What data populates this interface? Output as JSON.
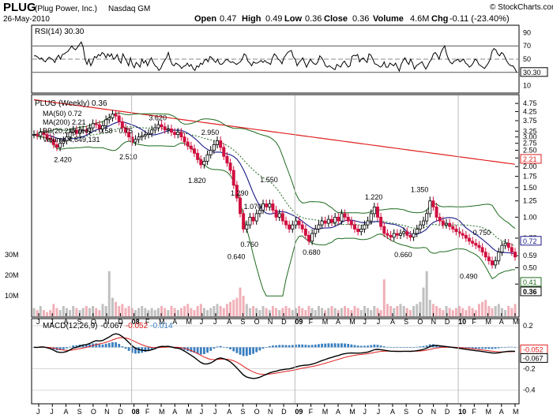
{
  "header": {
    "symbol": "PLUG",
    "company": "(Plug Power, Inc.)",
    "exchange": "Nasdaq GM",
    "date": "26-May-2010",
    "watermark": "© StockCharts.com",
    "open_label": "Open",
    "open": "0.47",
    "high_label": "High",
    "high": "0.49",
    "low_label": "Low",
    "low": "0.36",
    "close_label": "Close",
    "close": "0.36",
    "volume_label": "Volume",
    "volume": "4.6M",
    "chg_label": "Chg",
    "chg": "-0.11 (-23.40%)"
  },
  "colors": {
    "up_candle": "#000000",
    "down_candle": "#d01040",
    "ma50": "#1a1a8a",
    "ma200": "#e02020",
    "bollinger": "#1f6b1f",
    "bb_mid": "#1f6b1f",
    "volume": "#c0c0c0",
    "volume_down": "#f0b0b8",
    "macd_line": "#000000",
    "signal_line": "#e02020",
    "histogram": "#3a7fc0"
  },
  "chart_data": [
    {
      "type": "line",
      "panel": "rsi",
      "label": "RSI(14) 30.30",
      "ylim": [
        0,
        100
      ],
      "y_ticks": [
        10,
        30,
        50,
        70,
        90
      ],
      "overbought": 70,
      "oversold": 30,
      "last_value": "30.30",
      "values": [
        55,
        55,
        53,
        50,
        52,
        48,
        46,
        50,
        53,
        51,
        49,
        45,
        52,
        56,
        50,
        57,
        58,
        60,
        62,
        66,
        70,
        66,
        64,
        68,
        72,
        76,
        68,
        50,
        42,
        50,
        40,
        46,
        54,
        52,
        57,
        55,
        60,
        58,
        52,
        58,
        54,
        58,
        50,
        52,
        57,
        48,
        44,
        58,
        52,
        47,
        40,
        52,
        42,
        37,
        45,
        42,
        38,
        50,
        44,
        48,
        40,
        47,
        52,
        45,
        40,
        38,
        33,
        36,
        43,
        48,
        52,
        60,
        49,
        42,
        40,
        44,
        42,
        40,
        36,
        39,
        40,
        44,
        39,
        42,
        36,
        33,
        40,
        38,
        44,
        42,
        48,
        50,
        46,
        54,
        52,
        48,
        45,
        50,
        43,
        42,
        44,
        48,
        50,
        47,
        45,
        46,
        44,
        42,
        44,
        46,
        50,
        58,
        56,
        47,
        44,
        40,
        46,
        44,
        44,
        46,
        48,
        45,
        48,
        45,
        44,
        42,
        52,
        58,
        55,
        50,
        48,
        43,
        52,
        56,
        60,
        62,
        63,
        53,
        50,
        40,
        45,
        48,
        52,
        45,
        38,
        44,
        50,
        46,
        43,
        42,
        46,
        55,
        52,
        47,
        40,
        38,
        40,
        38,
        36,
        34,
        42,
        40,
        38,
        44,
        47,
        42,
        38,
        40,
        54,
        56,
        55,
        57,
        46,
        50,
        52,
        48,
        45,
        58,
        56,
        50,
        43,
        42,
        40,
        38,
        40,
        46,
        38,
        38,
        44,
        42,
        40,
        44,
        38,
        32,
        42,
        48,
        52,
        46,
        42,
        50,
        44,
        35,
        40,
        42,
        44,
        46,
        40,
        35,
        40,
        46,
        50,
        58,
        60,
        56,
        50,
        60,
        66,
        70,
        58,
        50,
        45,
        43,
        47,
        48,
        50,
        46,
        48,
        50,
        44,
        42,
        38,
        40,
        44,
        50,
        48,
        42,
        40,
        38,
        36,
        40,
        44,
        50,
        62,
        66,
        64,
        58,
        55,
        60,
        58,
        52,
        46,
        42,
        40,
        40,
        36,
        30
      ]
    },
    {
      "type": "candlestick",
      "panel": "price",
      "label": "PLUG (Weekly) 0.36",
      "scale": "log",
      "y_ticks": [
        0.4,
        0.5,
        0.59,
        0.75,
        1.0,
        1.25,
        1.5,
        1.75,
        2.0,
        2.25,
        2.5,
        2.75,
        3.0,
        3.25,
        3.75,
        4.25,
        4.75
      ],
      "y_tick_labels": [
        "0.40",
        "0.50",
        "0.59",
        "0.75",
        "1.00",
        "1.25",
        "1.50",
        "1.75",
        "2.00",
        "2.25",
        "2.50",
        "2.75",
        "3.00",
        "3.25",
        "3.75",
        "4.25",
        "4.75"
      ],
      "indicators": {
        "ma50": {
          "label": "MA(50) 0.72",
          "last": "0.72"
        },
        "ma200": {
          "label": "MA(200) 2.21",
          "last": "2.21"
        },
        "bb": {
          "label": "BB(20,2.0) 0.41 - 0.58 - 0.75",
          "upper": "0.75",
          "mid": "0.58",
          "lower": "0.41"
        },
        "volume": {
          "label": "Volume 4,649,131"
        }
      },
      "last_close_label": "0.36",
      "annotations": [
        {
          "label": "3.620",
          "x": 38,
          "y": 3.62
        },
        {
          "label": "2.420",
          "x": 9,
          "y": 2.42
        },
        {
          "label": "2.510",
          "x": 29,
          "y": 2.51
        },
        {
          "label": "2.950",
          "x": 54,
          "y": 2.95
        },
        {
          "label": "1.820",
          "x": 50,
          "y": 1.82
        },
        {
          "label": "1.550",
          "x": 72,
          "y": 1.55
        },
        {
          "label": "1.290",
          "x": 63,
          "y": 1.29
        },
        {
          "label": "1.070",
          "x": 67,
          "y": 1.07
        },
        {
          "label": "0.760",
          "x": 66,
          "y": 0.76
        },
        {
          "label": "0.640",
          "x": 62,
          "y": 0.64
        },
        {
          "label": "1.220",
          "x": 104,
          "y": 1.22
        },
        {
          "label": "0.680",
          "x": 85,
          "y": 0.68
        },
        {
          "label": "1.350",
          "x": 118,
          "y": 1.35
        },
        {
          "label": "0.660",
          "x": 113,
          "y": 0.66
        },
        {
          "label": "0.750",
          "x": 137,
          "y": 0.75
        },
        {
          "label": "0.490",
          "x": 133,
          "y": 0.49
        }
      ],
      "volume_axis": {
        "ticks": [
          10,
          20,
          30
        ],
        "tick_labels": [
          "10M",
          "20M",
          "30M"
        ]
      },
      "weeks": 148,
      "close": [
        3.1,
        3.05,
        3.2,
        3.1,
        2.95,
        2.9,
        2.7,
        2.6,
        2.75,
        2.85,
        3.0,
        3.2,
        3.3,
        3.15,
        3.3,
        3.3,
        3.25,
        3.4,
        3.6,
        3.55,
        3.35,
        3.5,
        3.8,
        3.9,
        4.1,
        4.0,
        3.7,
        3.4,
        3.2,
        3.0,
        2.8,
        2.9,
        3.0,
        3.05,
        3.1,
        3.15,
        3.3,
        3.4,
        3.55,
        3.45,
        3.3,
        3.35,
        3.2,
        3.1,
        3.2,
        3.0,
        2.8,
        2.65,
        2.55,
        2.4,
        2.2,
        2.05,
        2.15,
        2.35,
        2.5,
        2.7,
        2.85,
        2.6,
        2.3,
        2.1,
        1.9,
        1.55,
        1.3,
        1.05,
        0.85,
        0.9,
        1.0,
        0.95,
        1.05,
        1.1,
        1.2,
        1.15,
        1.2,
        1.1,
        1.0,
        1.05,
        0.95,
        0.9,
        0.85,
        0.9,
        0.95,
        0.9,
        0.85,
        0.78,
        0.72,
        0.8,
        0.85,
        0.9,
        0.95,
        0.92,
        0.97,
        0.93,
        1.0,
        0.95,
        1.05,
        1.0,
        0.95,
        0.9,
        0.85,
        0.82,
        0.85,
        0.9,
        0.95,
        1.05,
        1.15,
        1.0,
        0.88,
        0.8,
        0.78,
        0.76,
        0.8,
        0.78,
        0.8,
        0.82,
        0.78,
        0.76,
        0.8,
        0.85,
        0.9,
        0.95,
        1.05,
        1.25,
        1.15,
        1.0,
        0.95,
        0.9,
        0.92,
        0.88,
        0.85,
        0.82,
        0.8,
        0.78,
        0.75,
        0.72,
        0.7,
        0.68,
        0.66,
        0.62,
        0.58,
        0.55,
        0.52,
        0.55,
        0.62,
        0.68,
        0.7,
        0.66,
        0.62,
        0.58
      ],
      "volume": [
        4,
        3,
        5,
        3,
        2,
        3,
        6,
        4,
        3,
        5,
        4,
        3,
        5,
        4,
        3,
        4,
        5,
        4,
        5,
        4,
        3,
        6,
        5,
        22,
        9,
        7,
        5,
        6,
        4,
        5,
        4,
        3,
        4,
        5,
        4,
        3,
        4,
        3,
        4,
        5,
        4,
        3,
        5,
        4,
        3,
        4,
        5,
        6,
        4,
        3,
        5,
        6,
        4,
        3,
        4,
        5,
        6,
        5,
        4,
        6,
        7,
        8,
        9,
        14,
        10,
        6,
        4,
        5,
        4,
        3,
        5,
        4,
        3,
        5,
        4,
        3,
        4,
        5,
        4,
        3,
        4,
        5,
        4,
        3,
        5,
        4,
        3,
        5,
        4,
        3,
        4,
        5,
        4,
        3,
        4,
        5,
        4,
        3,
        5,
        4,
        3,
        5,
        4,
        3,
        5,
        4,
        3,
        18,
        6,
        5,
        4,
        5,
        6,
        5,
        4,
        3,
        5,
        6,
        7,
        14,
        22,
        8,
        6,
        5,
        4,
        3,
        5,
        4,
        3,
        4,
        5,
        4,
        3,
        5,
        4,
        3,
        6,
        7,
        8,
        5,
        4,
        5,
        6,
        4,
        3,
        5,
        4,
        6
      ]
    },
    {
      "type": "line",
      "panel": "macd",
      "label_prefix": "MACD(12,26,9)",
      "macd_value": "-0.067",
      "signal_value": "-0.052",
      "hist_value": "-0.014",
      "y_ticks": [
        0.2,
        0.0,
        -0.2,
        -0.4
      ],
      "y_tick_labels": [
        "0.2",
        "0.0",
        "-0.2",
        "-0.4"
      ],
      "right_labels": [
        "-0.052",
        "-0.067"
      ]
    },
    {
      "type": "axis",
      "x_tick_labels": [
        "J",
        "J",
        "A",
        "S",
        "O",
        "N",
        "D",
        "08",
        "F",
        "M",
        "A",
        "M",
        "J",
        "J",
        "A",
        "S",
        "O",
        "N",
        "D",
        "09",
        "F",
        "M",
        "A",
        "M",
        "J",
        "J",
        "A",
        "S",
        "O",
        "N",
        "D",
        "10",
        "F",
        "M",
        "A",
        "M"
      ]
    }
  ]
}
